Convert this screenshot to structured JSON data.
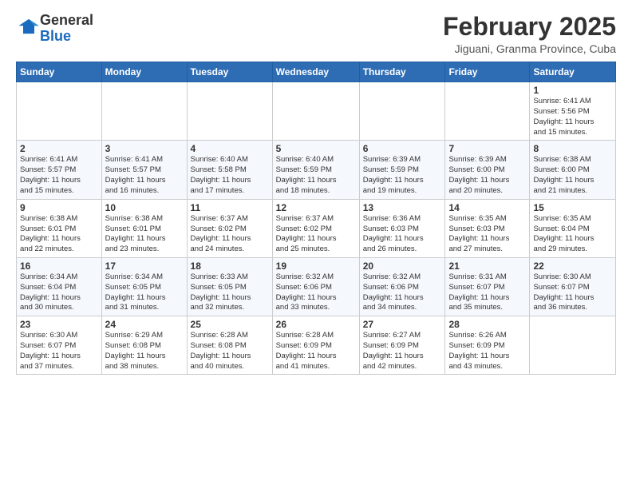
{
  "header": {
    "logo_general": "General",
    "logo_blue": "Blue",
    "month": "February 2025",
    "location": "Jiguani, Granma Province, Cuba"
  },
  "weekdays": [
    "Sunday",
    "Monday",
    "Tuesday",
    "Wednesday",
    "Thursday",
    "Friday",
    "Saturday"
  ],
  "weeks": [
    [
      {
        "day": "",
        "info": ""
      },
      {
        "day": "",
        "info": ""
      },
      {
        "day": "",
        "info": ""
      },
      {
        "day": "",
        "info": ""
      },
      {
        "day": "",
        "info": ""
      },
      {
        "day": "",
        "info": ""
      },
      {
        "day": "1",
        "info": "Sunrise: 6:41 AM\nSunset: 5:56 PM\nDaylight: 11 hours\nand 15 minutes."
      }
    ],
    [
      {
        "day": "2",
        "info": "Sunrise: 6:41 AM\nSunset: 5:57 PM\nDaylight: 11 hours\nand 15 minutes."
      },
      {
        "day": "3",
        "info": "Sunrise: 6:41 AM\nSunset: 5:57 PM\nDaylight: 11 hours\nand 16 minutes."
      },
      {
        "day": "4",
        "info": "Sunrise: 6:40 AM\nSunset: 5:58 PM\nDaylight: 11 hours\nand 17 minutes."
      },
      {
        "day": "5",
        "info": "Sunrise: 6:40 AM\nSunset: 5:59 PM\nDaylight: 11 hours\nand 18 minutes."
      },
      {
        "day": "6",
        "info": "Sunrise: 6:39 AM\nSunset: 5:59 PM\nDaylight: 11 hours\nand 19 minutes."
      },
      {
        "day": "7",
        "info": "Sunrise: 6:39 AM\nSunset: 6:00 PM\nDaylight: 11 hours\nand 20 minutes."
      },
      {
        "day": "8",
        "info": "Sunrise: 6:38 AM\nSunset: 6:00 PM\nDaylight: 11 hours\nand 21 minutes."
      }
    ],
    [
      {
        "day": "9",
        "info": "Sunrise: 6:38 AM\nSunset: 6:01 PM\nDaylight: 11 hours\nand 22 minutes."
      },
      {
        "day": "10",
        "info": "Sunrise: 6:38 AM\nSunset: 6:01 PM\nDaylight: 11 hours\nand 23 minutes."
      },
      {
        "day": "11",
        "info": "Sunrise: 6:37 AM\nSunset: 6:02 PM\nDaylight: 11 hours\nand 24 minutes."
      },
      {
        "day": "12",
        "info": "Sunrise: 6:37 AM\nSunset: 6:02 PM\nDaylight: 11 hours\nand 25 minutes."
      },
      {
        "day": "13",
        "info": "Sunrise: 6:36 AM\nSunset: 6:03 PM\nDaylight: 11 hours\nand 26 minutes."
      },
      {
        "day": "14",
        "info": "Sunrise: 6:35 AM\nSunset: 6:03 PM\nDaylight: 11 hours\nand 27 minutes."
      },
      {
        "day": "15",
        "info": "Sunrise: 6:35 AM\nSunset: 6:04 PM\nDaylight: 11 hours\nand 29 minutes."
      }
    ],
    [
      {
        "day": "16",
        "info": "Sunrise: 6:34 AM\nSunset: 6:04 PM\nDaylight: 11 hours\nand 30 minutes."
      },
      {
        "day": "17",
        "info": "Sunrise: 6:34 AM\nSunset: 6:05 PM\nDaylight: 11 hours\nand 31 minutes."
      },
      {
        "day": "18",
        "info": "Sunrise: 6:33 AM\nSunset: 6:05 PM\nDaylight: 11 hours\nand 32 minutes."
      },
      {
        "day": "19",
        "info": "Sunrise: 6:32 AM\nSunset: 6:06 PM\nDaylight: 11 hours\nand 33 minutes."
      },
      {
        "day": "20",
        "info": "Sunrise: 6:32 AM\nSunset: 6:06 PM\nDaylight: 11 hours\nand 34 minutes."
      },
      {
        "day": "21",
        "info": "Sunrise: 6:31 AM\nSunset: 6:07 PM\nDaylight: 11 hours\nand 35 minutes."
      },
      {
        "day": "22",
        "info": "Sunrise: 6:30 AM\nSunset: 6:07 PM\nDaylight: 11 hours\nand 36 minutes."
      }
    ],
    [
      {
        "day": "23",
        "info": "Sunrise: 6:30 AM\nSunset: 6:07 PM\nDaylight: 11 hours\nand 37 minutes."
      },
      {
        "day": "24",
        "info": "Sunrise: 6:29 AM\nSunset: 6:08 PM\nDaylight: 11 hours\nand 38 minutes."
      },
      {
        "day": "25",
        "info": "Sunrise: 6:28 AM\nSunset: 6:08 PM\nDaylight: 11 hours\nand 40 minutes."
      },
      {
        "day": "26",
        "info": "Sunrise: 6:28 AM\nSunset: 6:09 PM\nDaylight: 11 hours\nand 41 minutes."
      },
      {
        "day": "27",
        "info": "Sunrise: 6:27 AM\nSunset: 6:09 PM\nDaylight: 11 hours\nand 42 minutes."
      },
      {
        "day": "28",
        "info": "Sunrise: 6:26 AM\nSunset: 6:09 PM\nDaylight: 11 hours\nand 43 minutes."
      },
      {
        "day": "",
        "info": ""
      }
    ]
  ]
}
